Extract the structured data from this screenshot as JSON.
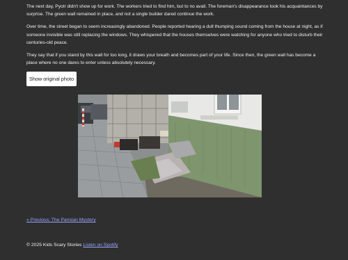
{
  "story": {
    "paragraphs": [
      "The next day, Pyotr didn't show up for work. The workers tried to find him, but to no avail. The foreman's disappearance took his acquaintances by surprise. The green wall remained in place, and not a single builder dared continue the work.",
      "Over time, the street began to seem increasingly abandoned. People reported hearing a dull thumping sound coming from the house at night, as if someone invisible was still replacing the windows. They whispered that the houses themselves were watching for anyone who tried to disturb their centuries-old peace.",
      "They say that if you stand by this wall for too long, it draws your breath and becomes part of your life. Since then, the green wall has become a place where no one dares to enter unless absolutely necessary."
    ]
  },
  "photo_button": {
    "label": "Show original photo"
  },
  "navigation": {
    "previous_label": "« Previous: The Parisian Mystery"
  },
  "footer": {
    "copyright": "© 2025 Kids Scary Stories",
    "spotify_label": "Listen on Spotify"
  },
  "colors": {
    "background": "#2f2f2f",
    "link": "#9aa7ff",
    "text": "#f2f2f2",
    "button_bg": "#ffffff"
  }
}
